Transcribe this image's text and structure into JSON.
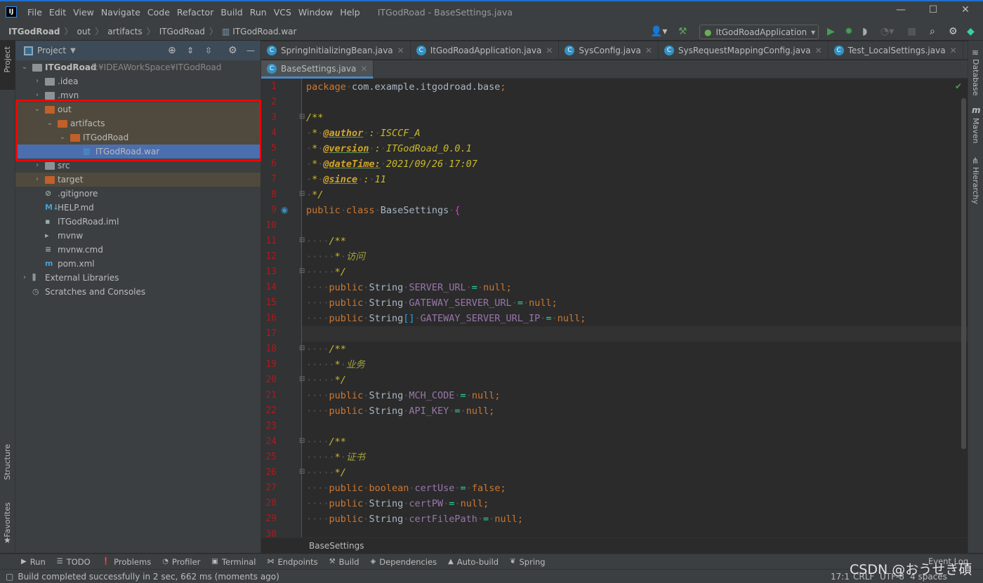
{
  "window": {
    "title": "ITGodRoad - BaseSettings.java",
    "logo": "IJ",
    "menu": [
      "File",
      "Edit",
      "View",
      "Navigate",
      "Code",
      "Refactor",
      "Build",
      "Run",
      "VCS",
      "Window",
      "Help"
    ]
  },
  "breadcrumb": [
    "ITGodRoad",
    "out",
    "artifacts",
    "ITGodRoad",
    "ITGodRoad.war"
  ],
  "toolbar": {
    "run_config": "ItGodRoadApplication"
  },
  "left_stripe": {
    "project": "Project",
    "structure": "Structure",
    "favorites": "Favorites"
  },
  "right_stripe": {
    "database": "Database",
    "maven": "Maven",
    "hierarchy": "Hierarchy"
  },
  "project_panel": {
    "title": "Project",
    "tree": [
      {
        "label": "ITGodRoad",
        "path": "F:¥IDEAWorkSpace¥ITGodRoad",
        "depth": 0,
        "icon": "module-folder-icon",
        "expanded": true
      },
      {
        "label": ".idea",
        "depth": 1,
        "icon": "folder-icon",
        "expanded": false
      },
      {
        "label": ".mvn",
        "depth": 1,
        "icon": "folder-icon",
        "expanded": false
      },
      {
        "label": "out",
        "depth": 1,
        "icon": "excluded-folder-icon",
        "expanded": true,
        "highlight": true
      },
      {
        "label": "artifacts",
        "depth": 2,
        "icon": "excluded-folder-icon",
        "expanded": true,
        "highlight": true
      },
      {
        "label": "ITGodRoad",
        "depth": 3,
        "icon": "excluded-folder-icon",
        "expanded": true,
        "highlight": true
      },
      {
        "label": "ITGodRoad.war",
        "depth": 4,
        "icon": "archive-icon",
        "selected": true
      },
      {
        "label": "src",
        "depth": 1,
        "icon": "folder-icon",
        "expanded": false
      },
      {
        "label": "target",
        "depth": 1,
        "icon": "excluded-folder-icon",
        "expanded": false,
        "highlight": true
      },
      {
        "label": ".gitignore",
        "depth": 1,
        "icon": "ignore-file-icon"
      },
      {
        "label": "HELP.md",
        "depth": 1,
        "icon": "markdown-icon"
      },
      {
        "label": "ITGodRoad.iml",
        "depth": 1,
        "icon": "iml-file-icon"
      },
      {
        "label": "mvnw",
        "depth": 1,
        "icon": "shell-icon"
      },
      {
        "label": "mvnw.cmd",
        "depth": 1,
        "icon": "text-file-icon"
      },
      {
        "label": "pom.xml",
        "depth": 1,
        "icon": "maven-icon"
      },
      {
        "label": "External Libraries",
        "depth": 0,
        "icon": "libraries-icon",
        "expanded": false
      },
      {
        "label": "Scratches and Consoles",
        "depth": 0,
        "icon": "scratches-icon"
      }
    ]
  },
  "tabs_row1": [
    "SpringInitializingBean.java",
    "ItGodRoadApplication.java",
    "SysConfig.java",
    "SysRequestMappingConfig.java",
    "Test_LocalSettings.java"
  ],
  "tabs_row2": [
    "BaseSettings.java"
  ],
  "editor": {
    "current_line": 17,
    "lines": [
      [
        [
          "kw",
          "package"
        ],
        [
          "ws",
          "·"
        ],
        [
          "id",
          "com.example.itgodroad.base"
        ],
        [
          "kw",
          ";"
        ]
      ],
      [],
      [
        [
          "cm",
          "/**"
        ]
      ],
      [
        [
          "ws",
          "·"
        ],
        [
          "cm",
          "*"
        ],
        [
          "ws",
          "·"
        ],
        [
          "tag",
          "@author"
        ],
        [
          "ws",
          "·"
        ],
        [
          "cm",
          ":"
        ],
        [
          "ws",
          "·"
        ],
        [
          "cm",
          "ISCCF_A"
        ]
      ],
      [
        [
          "ws",
          "·"
        ],
        [
          "cm",
          "*"
        ],
        [
          "ws",
          "·"
        ],
        [
          "tag",
          "@version"
        ],
        [
          "ws",
          "·"
        ],
        [
          "cm",
          ":"
        ],
        [
          "ws",
          "·"
        ],
        [
          "cm",
          "ITGodRoad_0.0.1"
        ]
      ],
      [
        [
          "ws",
          "·"
        ],
        [
          "cm",
          "*"
        ],
        [
          "ws",
          "·"
        ],
        [
          "tag",
          "@dateTime:"
        ],
        [
          "ws",
          "·"
        ],
        [
          "cm",
          "2021/09/26"
        ],
        [
          "ws",
          "·"
        ],
        [
          "cm",
          "17:07"
        ]
      ],
      [
        [
          "ws",
          "·"
        ],
        [
          "cm",
          "*"
        ],
        [
          "ws",
          "·"
        ],
        [
          "tag",
          "@since"
        ],
        [
          "ws",
          "·"
        ],
        [
          "cm",
          ":"
        ],
        [
          "ws",
          "·"
        ],
        [
          "cm",
          "11"
        ]
      ],
      [
        [
          "ws",
          "·"
        ],
        [
          "cm",
          "*/"
        ]
      ],
      [
        [
          "kw",
          "public"
        ],
        [
          "ws",
          "·"
        ],
        [
          "kw",
          "class"
        ],
        [
          "ws",
          "·"
        ],
        [
          "id",
          "BaseSettings"
        ],
        [
          "ws",
          "·"
        ],
        [
          "br",
          "{"
        ]
      ],
      [],
      [
        [
          "ws",
          "····"
        ],
        [
          "cm",
          "/**"
        ]
      ],
      [
        [
          "ws",
          "·····"
        ],
        [
          "cm",
          "*"
        ],
        [
          "ws",
          "·"
        ],
        [
          "cn",
          "访问"
        ]
      ],
      [
        [
          "ws",
          "·····"
        ],
        [
          "cm",
          "*/"
        ]
      ],
      [
        [
          "ws",
          "····"
        ],
        [
          "kw",
          "public"
        ],
        [
          "ws",
          "·"
        ],
        [
          "id",
          "String"
        ],
        [
          "ws",
          "·"
        ],
        [
          "fld",
          "SERVER_URL"
        ],
        [
          "ws",
          "·"
        ],
        [
          "op",
          "="
        ],
        [
          "ws",
          "·"
        ],
        [
          "kw",
          "null;"
        ]
      ],
      [
        [
          "ws",
          "····"
        ],
        [
          "kw",
          "public"
        ],
        [
          "ws",
          "·"
        ],
        [
          "id",
          "String"
        ],
        [
          "ws",
          "·"
        ],
        [
          "fld",
          "GATEWAY_SERVER_URL"
        ],
        [
          "ws",
          "·"
        ],
        [
          "op",
          "="
        ],
        [
          "ws",
          "·"
        ],
        [
          "kw",
          "null;"
        ]
      ],
      [
        [
          "ws",
          "····"
        ],
        [
          "kw",
          "public"
        ],
        [
          "ws",
          "·"
        ],
        [
          "id",
          "String"
        ],
        [
          "arr",
          "[]"
        ],
        [
          "ws",
          "·"
        ],
        [
          "fld",
          "GATEWAY_SERVER_URL_IP"
        ],
        [
          "ws",
          "·"
        ],
        [
          "op",
          "="
        ],
        [
          "ws",
          "·"
        ],
        [
          "kw",
          "null;"
        ]
      ],
      [],
      [
        [
          "ws",
          "····"
        ],
        [
          "cm",
          "/**"
        ]
      ],
      [
        [
          "ws",
          "·····"
        ],
        [
          "cm",
          "*"
        ],
        [
          "ws",
          "·"
        ],
        [
          "cn",
          "业务"
        ]
      ],
      [
        [
          "ws",
          "·····"
        ],
        [
          "cm",
          "*/"
        ]
      ],
      [
        [
          "ws",
          "····"
        ],
        [
          "kw",
          "public"
        ],
        [
          "ws",
          "·"
        ],
        [
          "id",
          "String"
        ],
        [
          "ws",
          "·"
        ],
        [
          "fld",
          "MCH_CODE"
        ],
        [
          "ws",
          "·"
        ],
        [
          "op",
          "="
        ],
        [
          "ws",
          "·"
        ],
        [
          "kw",
          "null;"
        ]
      ],
      [
        [
          "ws",
          "····"
        ],
        [
          "kw",
          "public"
        ],
        [
          "ws",
          "·"
        ],
        [
          "id",
          "String"
        ],
        [
          "ws",
          "·"
        ],
        [
          "fld",
          "API_KEY"
        ],
        [
          "ws",
          "·"
        ],
        [
          "op",
          "="
        ],
        [
          "ws",
          "·"
        ],
        [
          "kw",
          "null;"
        ]
      ],
      [],
      [
        [
          "ws",
          "····"
        ],
        [
          "cm",
          "/**"
        ]
      ],
      [
        [
          "ws",
          "·····"
        ],
        [
          "cm",
          "*"
        ],
        [
          "ws",
          "·"
        ],
        [
          "cn",
          "证书"
        ]
      ],
      [
        [
          "ws",
          "·····"
        ],
        [
          "cm",
          "*/"
        ]
      ],
      [
        [
          "ws",
          "····"
        ],
        [
          "kw",
          "public"
        ],
        [
          "ws",
          "·"
        ],
        [
          "kw",
          "boolean"
        ],
        [
          "ws",
          "·"
        ],
        [
          "fld",
          "certUse"
        ],
        [
          "ws",
          "·"
        ],
        [
          "op",
          "="
        ],
        [
          "ws",
          "·"
        ],
        [
          "kw",
          "false;"
        ]
      ],
      [
        [
          "ws",
          "····"
        ],
        [
          "kw",
          "public"
        ],
        [
          "ws",
          "·"
        ],
        [
          "id",
          "String"
        ],
        [
          "ws",
          "·"
        ],
        [
          "fld",
          "certPW"
        ],
        [
          "ws",
          "·"
        ],
        [
          "op",
          "="
        ],
        [
          "ws",
          "·"
        ],
        [
          "kw",
          "null;"
        ]
      ],
      [
        [
          "ws",
          "····"
        ],
        [
          "kw",
          "public"
        ],
        [
          "ws",
          "·"
        ],
        [
          "id",
          "String"
        ],
        [
          "ws",
          "·"
        ],
        [
          "fld",
          "certFilePath"
        ],
        [
          "ws",
          "·"
        ],
        [
          "op",
          "="
        ],
        [
          "ws",
          "·"
        ],
        [
          "kw",
          "null;"
        ]
      ],
      []
    ],
    "breadcrumb": "BaseSettings"
  },
  "tool_windows": [
    "Run",
    "TODO",
    "Problems",
    "Profiler",
    "Terminal",
    "Endpoints",
    "Build",
    "Dependencies",
    "Auto-build",
    "Spring"
  ],
  "event_log": "Event Log",
  "status": {
    "message": "Build completed successfully in 2 sec, 662 ms (moments ago)",
    "position": "17:1",
    "line_sep": "CRLF",
    "encoding": "UTF-8",
    "indent": "4 spaces"
  },
  "watermark": "CSDN @おうせき碩",
  "colors": {
    "accent": "#4b6eaf",
    "excluded_highlight": "#4f4a3d",
    "annotation_box": "#ff0000",
    "line_numbers": "#b01a1a"
  }
}
